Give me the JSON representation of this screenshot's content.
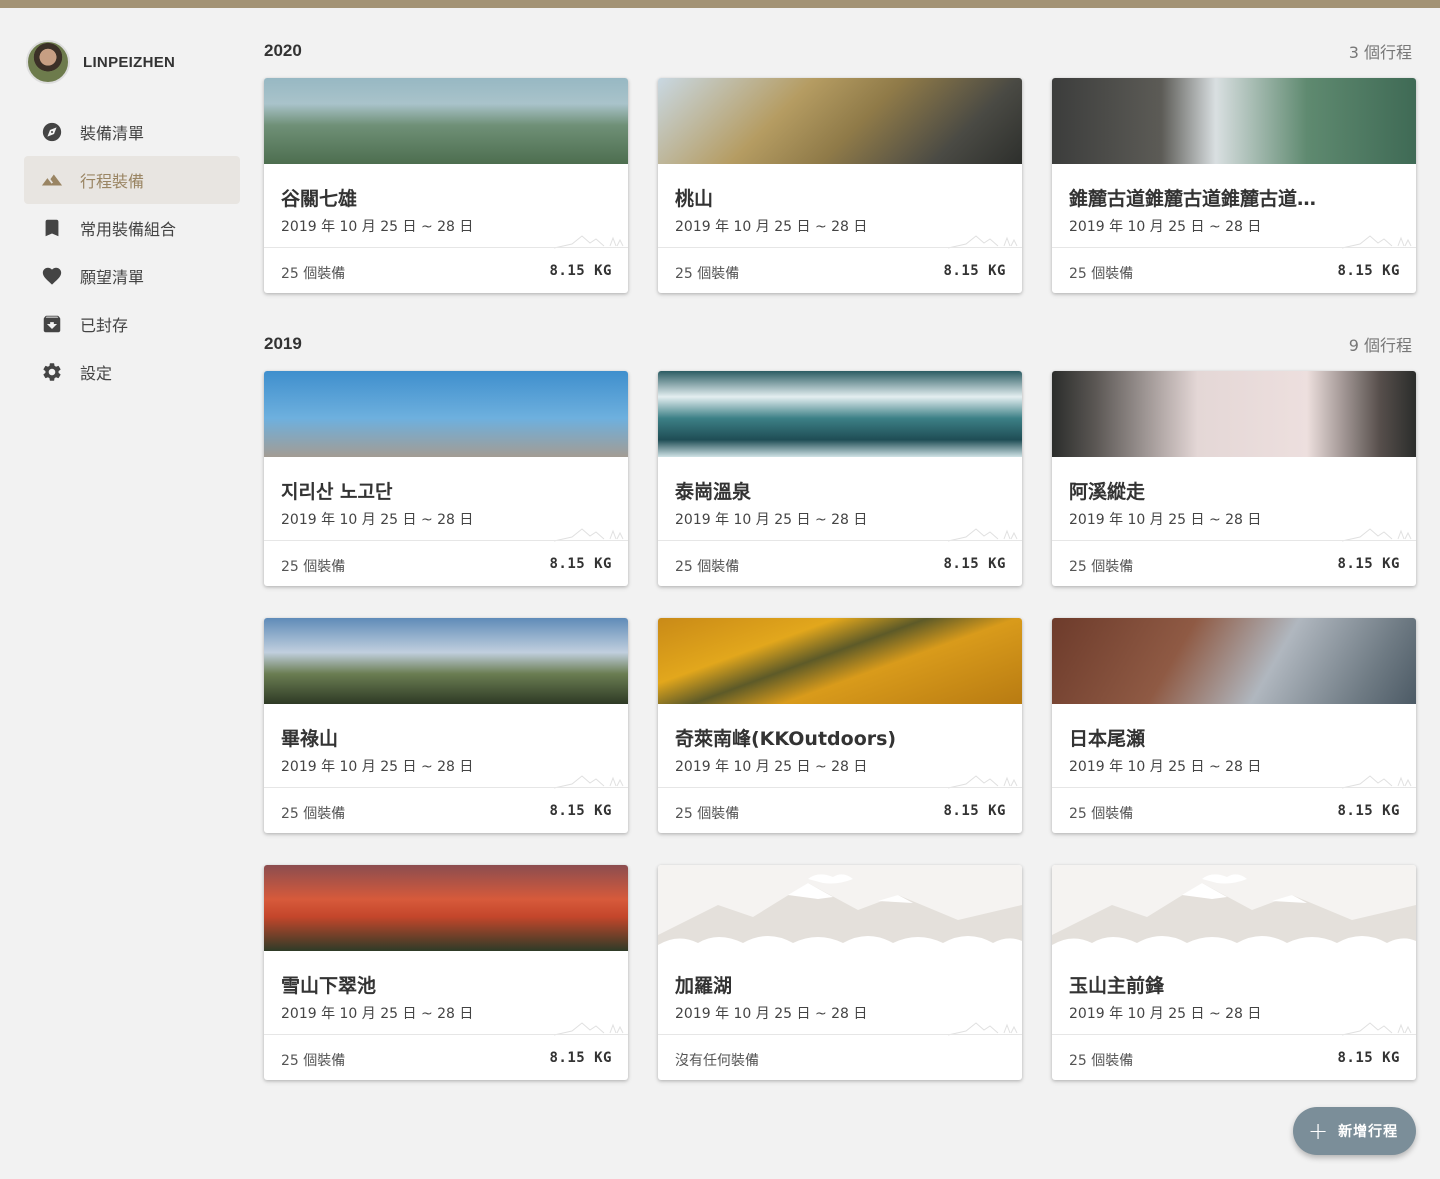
{
  "user": {
    "name": "LINPEIZHEN"
  },
  "nav": [
    {
      "icon": "compass-icon",
      "label": "裝備清單",
      "active": false
    },
    {
      "icon": "mountain-icon",
      "label": "行程裝備",
      "active": true
    },
    {
      "icon": "bookmark-icon",
      "label": "常用裝備組合",
      "active": false
    },
    {
      "icon": "heart-icon",
      "label": "願望清單",
      "active": false
    },
    {
      "icon": "archive-icon",
      "label": "已封存",
      "active": false
    },
    {
      "icon": "gear-icon",
      "label": "設定",
      "active": false
    }
  ],
  "colors": {
    "accent": "#a39375",
    "active_text": "#9a8563",
    "fab": "#7b8e99"
  },
  "sections": [
    {
      "year": "2020",
      "count": "3 個行程",
      "trips": [
        {
          "title": "谷關七雄",
          "date": "2019 年 10 月 25 日 ~ 28 日",
          "items": "25  個裝備",
          "weight": "8.15 KG",
          "image": "mountain-green"
        },
        {
          "title": "桃山",
          "date": "2019 年 10 月 25 日 ~ 28 日",
          "items": "25  個裝備",
          "weight": "8.15 KG",
          "image": "dry-ridge"
        },
        {
          "title": "錐麓古道錐麓古道錐麓古道…",
          "date": "2019 年 10 月 25 日 ~ 28 日",
          "items": "25  個裝備",
          "weight": "8.15 KG",
          "image": "cliff-trail"
        }
      ]
    },
    {
      "year": "2019",
      "count": "9 個行程",
      "trips": [
        {
          "title": "지리산 노고단",
          "date": "2019 年 10 月 25 日 ~ 28 日",
          "items": "25  個裝備",
          "weight": "8.15 KG",
          "image": "hikers-rock"
        },
        {
          "title": "泰崗溫泉",
          "date": "2019 年 10 月 25 日 ~ 28 日",
          "items": "25  個裝備",
          "weight": "8.15 KG",
          "image": "river"
        },
        {
          "title": "阿溪縱走",
          "date": "2019 年 10 月 25 日 ~ 28 日",
          "items": "25  個裝備",
          "weight": "8.15 KG",
          "image": "misty-forest"
        },
        {
          "title": "畢祿山",
          "date": "2019 年 10 月 25 日 ~ 28 日",
          "items": "25  個裝備",
          "weight": "8.15 KG",
          "image": "mountain-blue"
        },
        {
          "title": "奇萊南峰(KKOutdoors)",
          "date": "2019 年 10 月 25 日 ~ 28 日",
          "items": "25  個裝備",
          "weight": "8.15 KG",
          "image": "golden-grass"
        },
        {
          "title": "日本尾瀬",
          "date": "2019 年 10 月 25 日 ~ 28 日",
          "items": "25  個裝備",
          "weight": "8.15 KG",
          "image": "autumn-forest"
        },
        {
          "title": "雪山下翠池",
          "date": "2019 年 10 月 25 日 ~ 28 日",
          "items": "25  個裝備",
          "weight": "8.15 KG",
          "image": "sunset-forest"
        },
        {
          "title": "加羅湖",
          "date": "2019 年 10 月 25 日 ~ 28 日",
          "items": "沒有任何裝備",
          "weight": "",
          "image": "placeholder"
        },
        {
          "title": "玉山主前鋒",
          "date": "2019 年 10 月 25 日 ~ 28 日",
          "items": "25  個裝備",
          "weight": "8.15 KG",
          "image": "placeholder"
        }
      ]
    }
  ],
  "fab": {
    "icon": "plus-icon",
    "label": "新增行程"
  }
}
